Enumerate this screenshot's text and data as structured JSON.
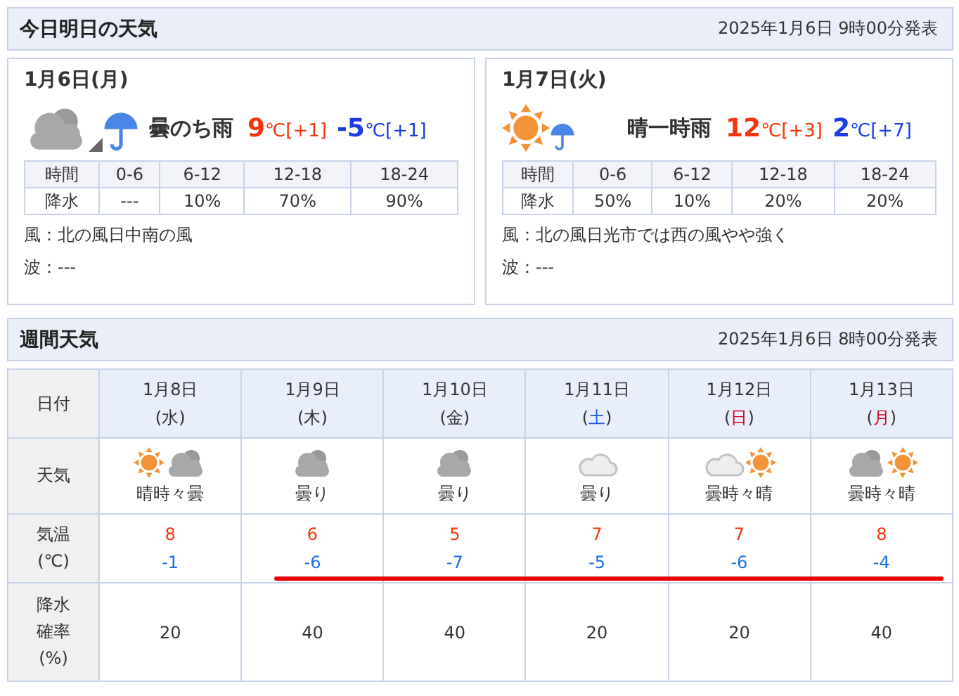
{
  "today_section": {
    "title": "今日明日の天気",
    "issued": "2025年1月6日 9時00分発表",
    "days": [
      {
        "date": "1月6日(月)",
        "icons": [
          {
            "kind": "cloud-dark"
          },
          {
            "kind": "then"
          },
          {
            "kind": "umbrella"
          }
        ],
        "weather": "曇のち雨",
        "high": {
          "value": "9",
          "unit": "℃",
          "diff": "[+1]"
        },
        "low": {
          "value": "-5",
          "unit": "℃",
          "diff": "[+1]"
        },
        "precip_header": [
          "時間",
          "0-6",
          "6-12",
          "12-18",
          "18-24"
        ],
        "precip_row": [
          "降水",
          "---",
          "10%",
          "70%",
          "90%"
        ],
        "wind": "風：北の風日中南の風",
        "wave": "波：---"
      },
      {
        "date": "1月7日(火)",
        "icons": [
          {
            "kind": "sun"
          },
          {
            "kind": "umbrella-small"
          }
        ],
        "weather": "晴一時雨",
        "high": {
          "value": "12",
          "unit": "℃",
          "diff": "[+3]"
        },
        "low": {
          "value": "2",
          "unit": "℃",
          "diff": "[+7]"
        },
        "precip_header": [
          "時間",
          "0-6",
          "6-12",
          "12-18",
          "18-24"
        ],
        "precip_row": [
          "降水",
          "50%",
          "10%",
          "20%",
          "20%"
        ],
        "wind": "風：北の風日光市では西の風やや強く",
        "wave": "波：---"
      }
    ]
  },
  "weekly_section": {
    "title": "週間天気",
    "issued": "2025年1月6日 8時00分発表",
    "row_labels": {
      "date": "日付",
      "weather": "天気",
      "temp": [
        "気温",
        "(℃)"
      ],
      "precip": [
        "降水",
        "確率",
        "(%)"
      ]
    },
    "days": [
      {
        "date": "1月8日",
        "weekday": "(水)",
        "color": "#333333",
        "icons": [
          {
            "kind": "sun"
          },
          {
            "kind": "cloud-dark"
          }
        ],
        "weather": "晴時々曇",
        "high": "8",
        "low": "-1",
        "precip": "20"
      },
      {
        "date": "1月9日",
        "weekday": "(木)",
        "color": "#333333",
        "icons": [
          {
            "kind": "cloud-dark"
          }
        ],
        "weather": "曇り",
        "high": "6",
        "low": "-6",
        "precip": "40"
      },
      {
        "date": "1月10日",
        "weekday": "(金)",
        "color": "#333333",
        "icons": [
          {
            "kind": "cloud-dark"
          }
        ],
        "weather": "曇り",
        "high": "5",
        "low": "-7",
        "precip": "40"
      },
      {
        "date": "1月11日",
        "weekday": "(土)",
        "color": "#1e5ad6",
        "icons": [
          {
            "kind": "cloud-light"
          }
        ],
        "weather": "曇り",
        "high": "7",
        "low": "-5",
        "precip": "20"
      },
      {
        "date": "1月12日",
        "weekday": "(日)",
        "color": "#d0021b",
        "icons": [
          {
            "kind": "cloud-light"
          },
          {
            "kind": "sun"
          }
        ],
        "weather": "曇時々晴",
        "high": "7",
        "low": "-6",
        "precip": "20"
      },
      {
        "date": "1月13日",
        "weekday": "(月)",
        "color": "#d0021b",
        "icons": [
          {
            "kind": "cloud-dark"
          },
          {
            "kind": "sun"
          }
        ],
        "weather": "曇時々晴",
        "high": "8",
        "low": "-4",
        "precip": "40"
      }
    ]
  }
}
